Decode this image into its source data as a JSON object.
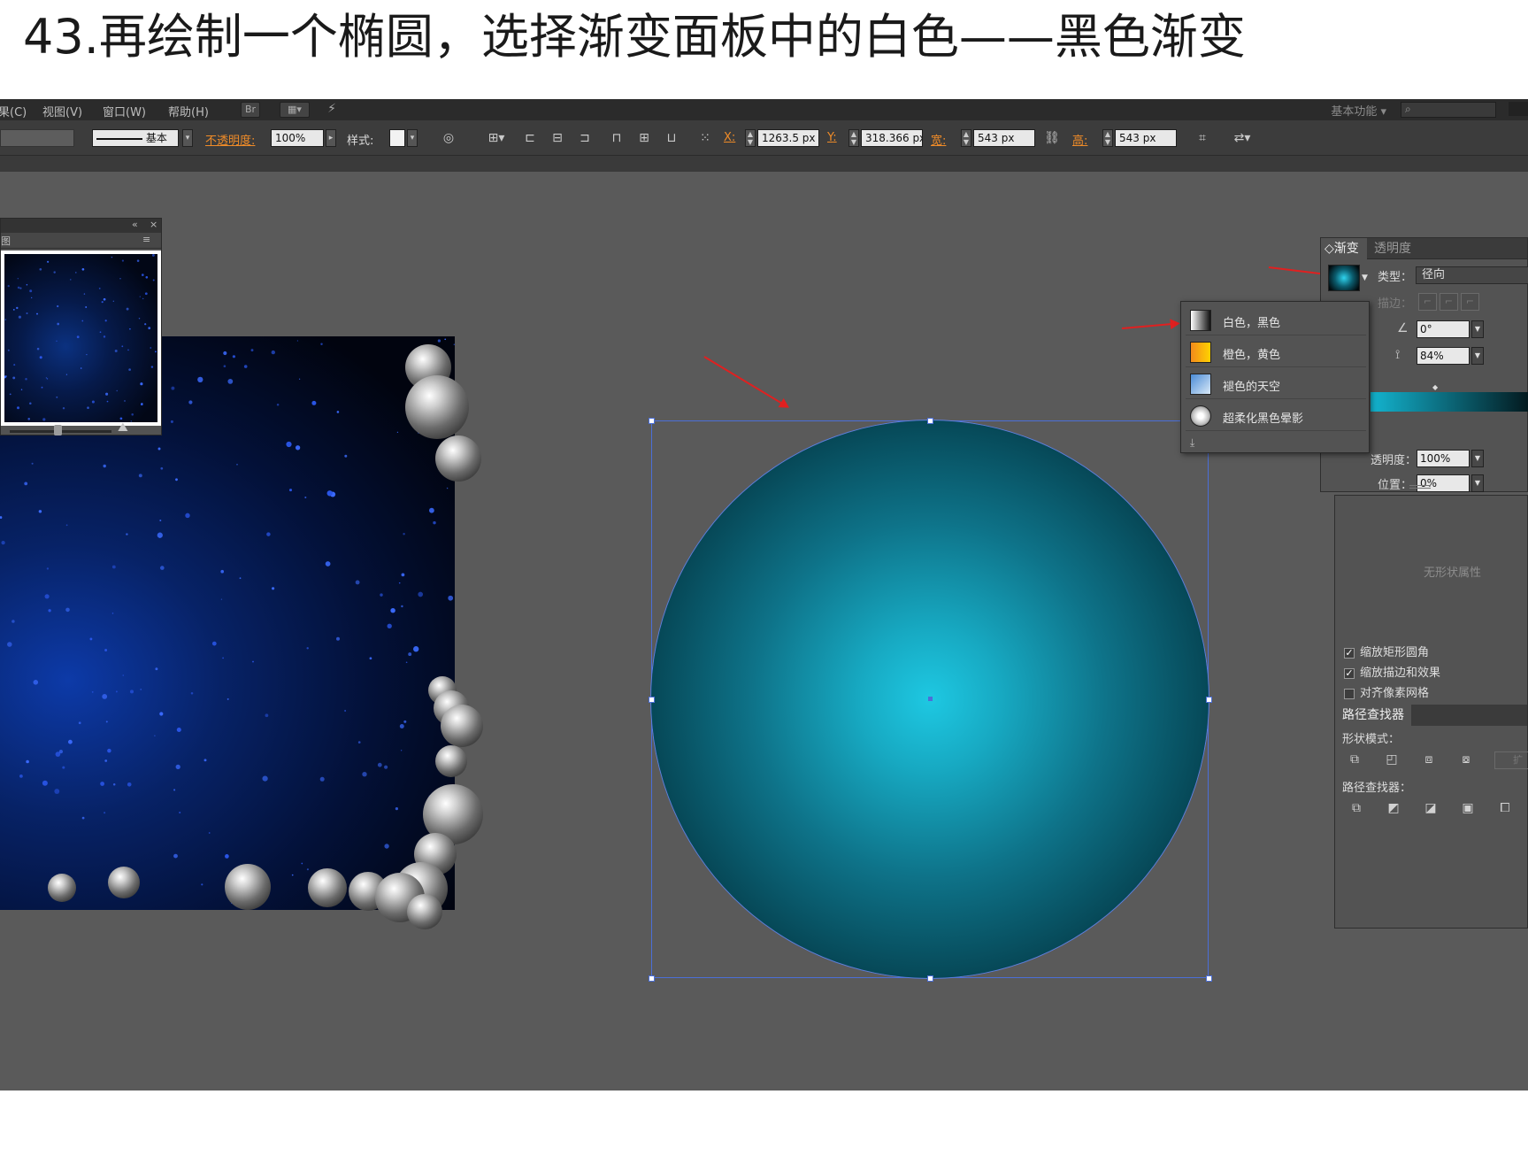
{
  "title": "43.再绘制一个椭圆，选择渐变面板中的白色——黑色渐变",
  "menu": {
    "items": [
      "果(C)",
      "视图(V)",
      "窗口(W)",
      "帮助(H)"
    ],
    "bridge": "Br",
    "workspace": "基本功能"
  },
  "control_bar": {
    "stroke_style": "基本",
    "opacity_label": "不透明度",
    "opacity_value": "100%",
    "style_label": "样式",
    "x_label": "X",
    "x_value": "1263.5 px",
    "y_label": "Y",
    "y_value": "318.366 px",
    "w_label": "宽",
    "w_value": "543 px",
    "h_label": "高",
    "h_value": "543 px"
  },
  "navigator": {
    "tab": "图"
  },
  "gradient_panel": {
    "tab_active": "渐变",
    "tab_other": "透明度",
    "type_label": "类型",
    "type_value": "径向",
    "stroke_label": "描边",
    "angle_value": "0°",
    "ratio_value": "84%",
    "opacity_label": "透明度",
    "opacity_value": "100%",
    "position_label": "位置",
    "position_value": "0%",
    "presets": [
      {
        "name": "白色，黑色",
        "swatch": "linear-gradient(to right,#ffffff,#111111)"
      },
      {
        "name": "橙色，黄色",
        "swatch": "linear-gradient(to right,#f28a1c,#ffd200)"
      },
      {
        "name": "褪色的天空",
        "swatch": "linear-gradient(to bottom right,#4a8bd6,#d9e9f7)"
      },
      {
        "name": "超柔化黑色晕影",
        "swatch": "radial-gradient(circle,#ffffff 20%,#bcbcbc 60%,#333 100%)"
      }
    ]
  },
  "lower_panel": {
    "no_shape_text": "无形状属性",
    "options": [
      {
        "label": "缩放矩形圆角",
        "checked": true
      },
      {
        "label": "缩放描边和效果",
        "checked": true
      },
      {
        "label": "对齐像素网格",
        "checked": false
      }
    ],
    "pathfinder_tab": "路径查找器",
    "shape_modes_label": "形状模式",
    "pathfinders_label": "路径查找器",
    "expand_label": "扩"
  },
  "colors": {
    "selection": "#4b6fd8",
    "annotation_arrow": "#e02020",
    "accent_label": "#f08c28"
  }
}
